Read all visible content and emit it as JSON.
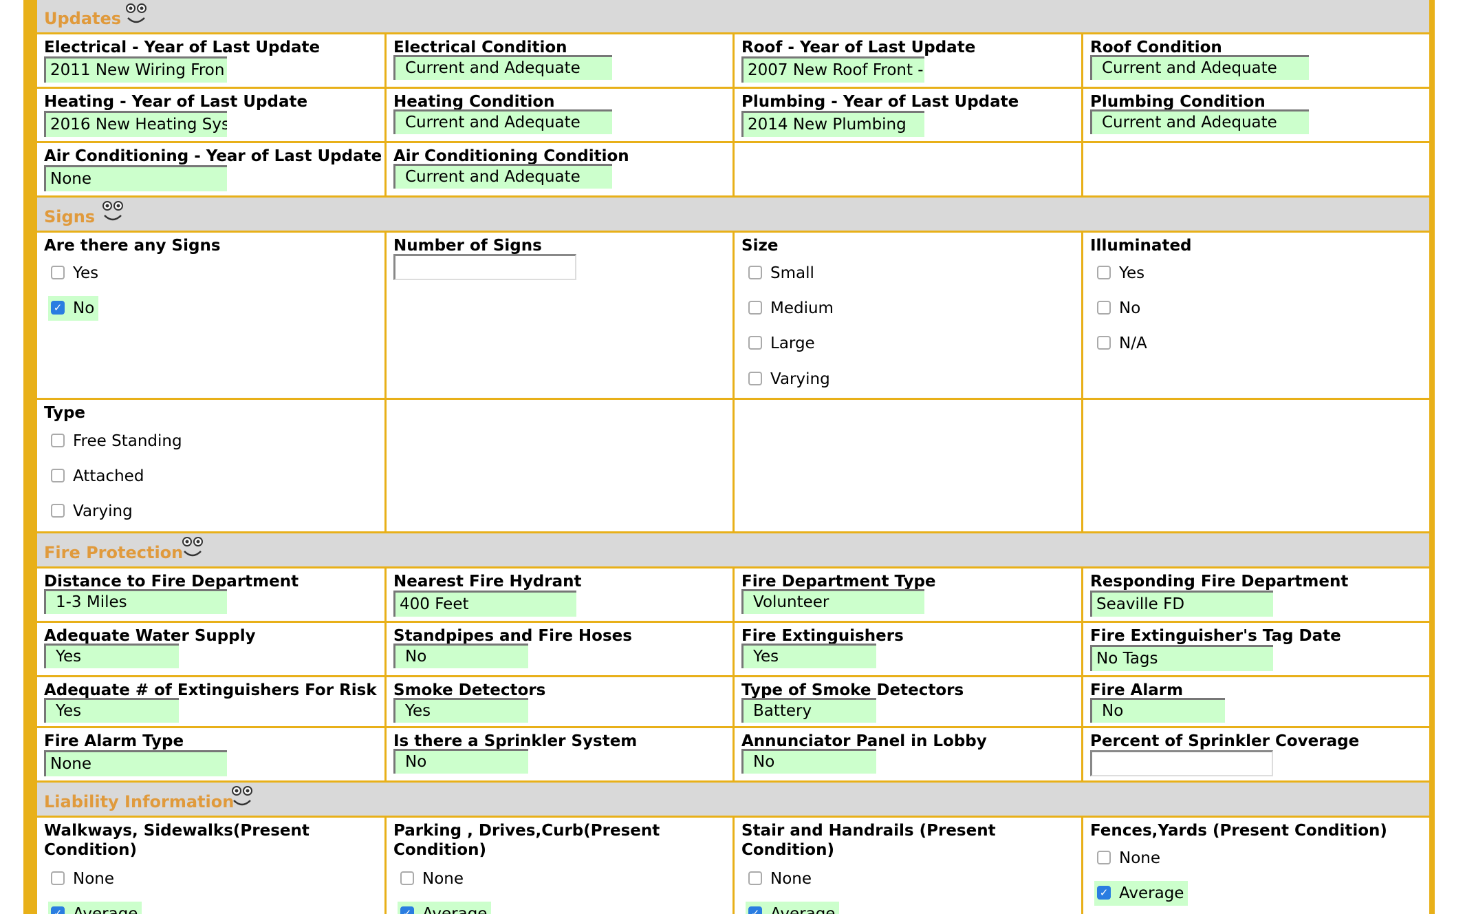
{
  "colors": {
    "accent": "#e8b019",
    "section_title": "#e09a3c",
    "field_bg": "#ccffcc",
    "header_bg": "#d9d9d9",
    "check": "#2a7de1"
  },
  "icons": {
    "section": "smiley-face-icon"
  },
  "updates": {
    "title": "Updates",
    "electrical_year": {
      "label": "Electrical - Year of Last Update",
      "value": "2011 New Wiring Fron"
    },
    "electrical_cond": {
      "label": "Electrical Condition",
      "value": "Current and Adequate"
    },
    "roof_year": {
      "label": "Roof - Year of Last Update",
      "value": "2007 New Roof Front -"
    },
    "roof_cond": {
      "label": "Roof Condition",
      "value": "Current and Adequate"
    },
    "heating_year": {
      "label": "Heating - Year of Last Update",
      "value": "2016 New Heating Sys"
    },
    "heating_cond": {
      "label": "Heating Condition",
      "value": "Current and Adequate"
    },
    "plumbing_year": {
      "label": "Plumbing - Year of Last Update",
      "value": "2014 New Plumbing"
    },
    "plumbing_cond": {
      "label": "Plumbing Condition",
      "value": "Current and Adequate"
    },
    "ac_year": {
      "label": "Air Conditioning - Year of Last Update",
      "value": "None"
    },
    "ac_cond": {
      "label": "Air Conditioning Condition",
      "value": "Current and Adequate"
    }
  },
  "signs": {
    "title": "Signs",
    "any": {
      "label": "Are there any Signs",
      "options": [
        "Yes",
        "No"
      ],
      "checked": "No"
    },
    "number": {
      "label": "Number of Signs",
      "value": ""
    },
    "size": {
      "label": "Size",
      "options": [
        "Small",
        "Medium",
        "Large",
        "Varying"
      ]
    },
    "illuminated": {
      "label": "Illuminated",
      "options": [
        "Yes",
        "No",
        "N/A"
      ]
    },
    "type": {
      "label": "Type",
      "options": [
        "Free Standing",
        "Attached",
        "Varying"
      ]
    }
  },
  "fire": {
    "title": "Fire Protection",
    "distance": {
      "label": "Distance to Fire Department",
      "value": "1-3 Miles"
    },
    "hydrant": {
      "label": "Nearest Fire Hydrant",
      "value": "400 Feet"
    },
    "dept_type": {
      "label": "Fire Department Type",
      "value": "Volunteer"
    },
    "responding": {
      "label": "Responding Fire Department",
      "value": "Seaville FD"
    },
    "water": {
      "label": "Adequate Water Supply",
      "value": "Yes"
    },
    "standpipes": {
      "label": "Standpipes and Fire Hoses",
      "value": "No"
    },
    "extinguishers": {
      "label": "Fire Extinguishers",
      "value": "Yes"
    },
    "tag_date": {
      "label": "Fire Extinguisher's Tag Date",
      "value": "No Tags"
    },
    "adequate_ext": {
      "label": "Adequate # of Extinguishers For Risk",
      "value": "Yes"
    },
    "smoke": {
      "label": "Smoke Detectors",
      "value": "Yes"
    },
    "smoke_type": {
      "label": "Type of Smoke Detectors",
      "value": "Battery"
    },
    "alarm": {
      "label": "Fire Alarm",
      "value": "No"
    },
    "alarm_type": {
      "label": "Fire Alarm Type",
      "value": "None"
    },
    "sprinkler": {
      "label": "Is there a Sprinkler System",
      "value": "No"
    },
    "annunciator": {
      "label": "Annunciator Panel in Lobby",
      "value": "No"
    },
    "sprinkler_pct": {
      "label": "Percent of Sprinkler Coverage",
      "value": ""
    }
  },
  "liability": {
    "title": "Liability Information",
    "walkways": {
      "label": "Walkways, Sidewalks(Present Condition)",
      "options": [
        "None",
        "Average"
      ],
      "checked": "Average"
    },
    "parking": {
      "label": "Parking , Drives,Curb(Present Condition)",
      "options": [
        "None",
        "Average"
      ],
      "checked": "Average"
    },
    "stairs": {
      "label": "Stair and Handrails (Present Condition)",
      "options": [
        "None",
        "Average"
      ],
      "checked": "Average"
    },
    "fences": {
      "label": "Fences,Yards (Present Condition)",
      "options": [
        "None",
        "Average"
      ],
      "checked": "Average"
    }
  }
}
